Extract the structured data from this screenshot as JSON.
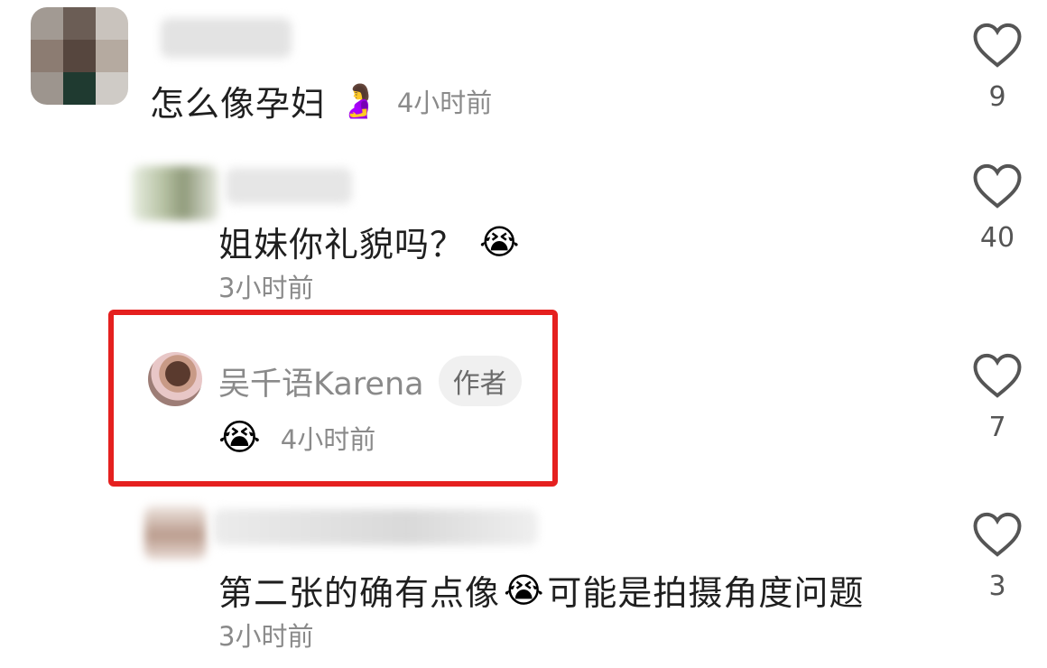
{
  "comments": [
    {
      "text": "怎么像孕妇",
      "emoji": "🤰",
      "time": "4小时前",
      "likes": "9"
    },
    {
      "text": "姐妹你礼貌吗？",
      "emoji": "😭",
      "time": "3小时前",
      "likes": "40"
    },
    {
      "author": "吴千语Karena",
      "badge": "作者",
      "emoji": "😭",
      "time": "4小时前",
      "likes": "7"
    },
    {
      "text_before": "第二张的确有点像",
      "emoji": "😭",
      "text_after": "可能是拍摄角度问题",
      "time": "3小时前",
      "likes": "3"
    }
  ],
  "colors": {
    "highlight": "#e5201f",
    "text": "#1f1f1f",
    "meta": "#8a8a8a"
  }
}
